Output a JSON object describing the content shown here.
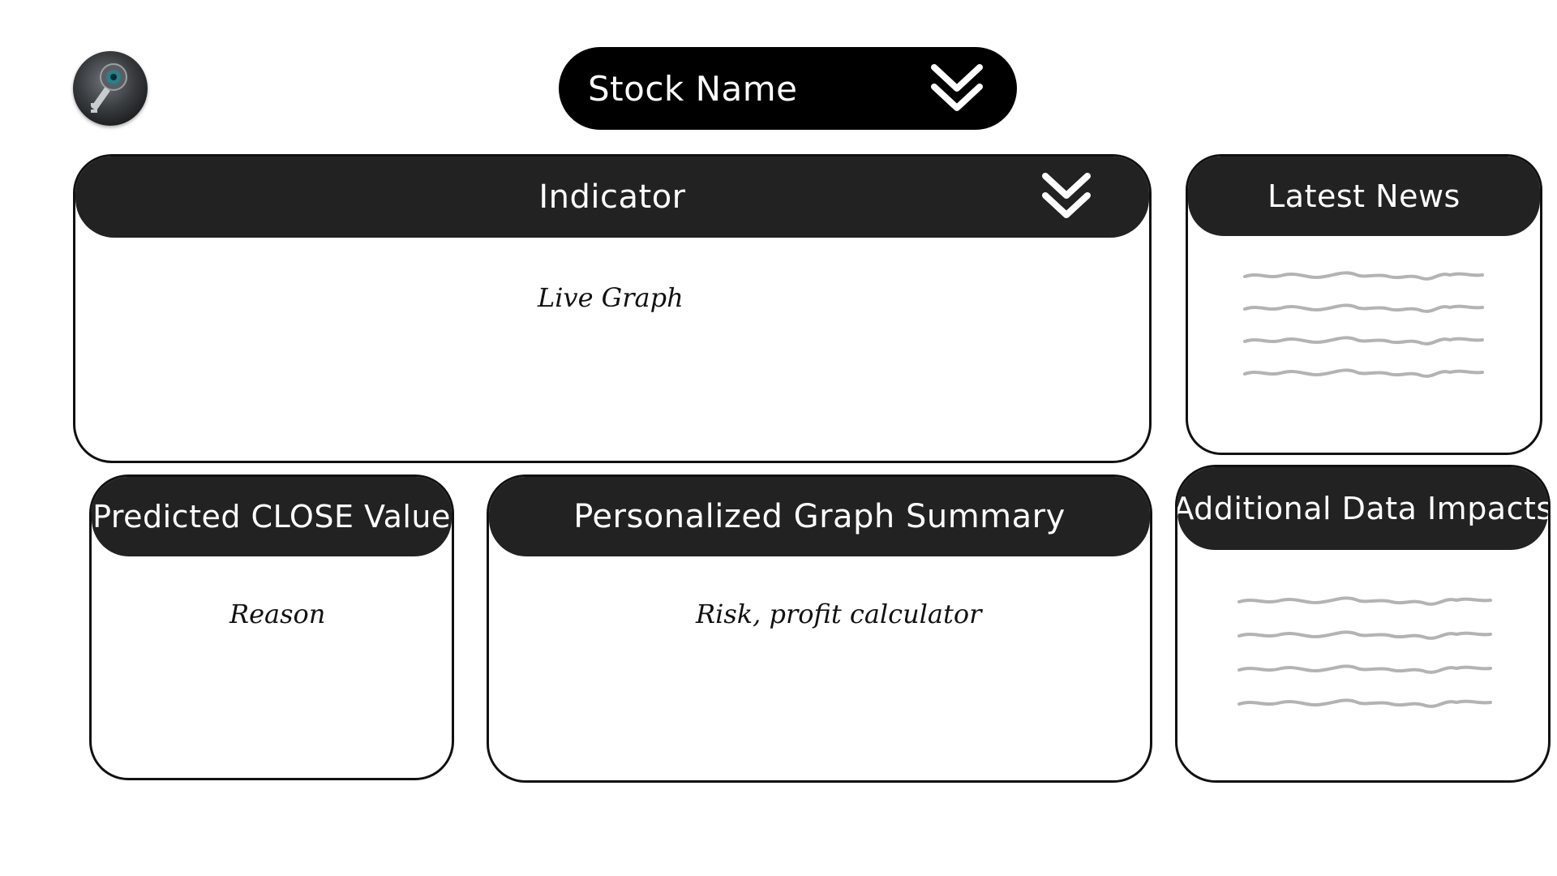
{
  "header": {
    "logo_icon": "key-lens-logo-icon",
    "stock_select": {
      "label": "Stock Name",
      "icon": "double-chevron-down-icon"
    }
  },
  "panels": {
    "indicator": {
      "title": "Indicator",
      "body_text": "Live Graph",
      "icon": "double-chevron-down-icon"
    },
    "latest_news": {
      "title": "Latest News",
      "placeholder": "squiggle-text-lines"
    },
    "predicted_close": {
      "title": "Predicted CLOSE Value",
      "body_text": "Reason"
    },
    "graph_summary": {
      "title": "Personalized Graph Summary",
      "body_text": "Risk, profit calculator"
    },
    "additional_data": {
      "title": "Additional Data Impacts",
      "placeholder": "squiggle-text-lines"
    }
  },
  "colors": {
    "header_bar": "#222222",
    "selector_bg": "#000000",
    "placeholder_line": "#b3b3b3",
    "border": "#111111"
  }
}
